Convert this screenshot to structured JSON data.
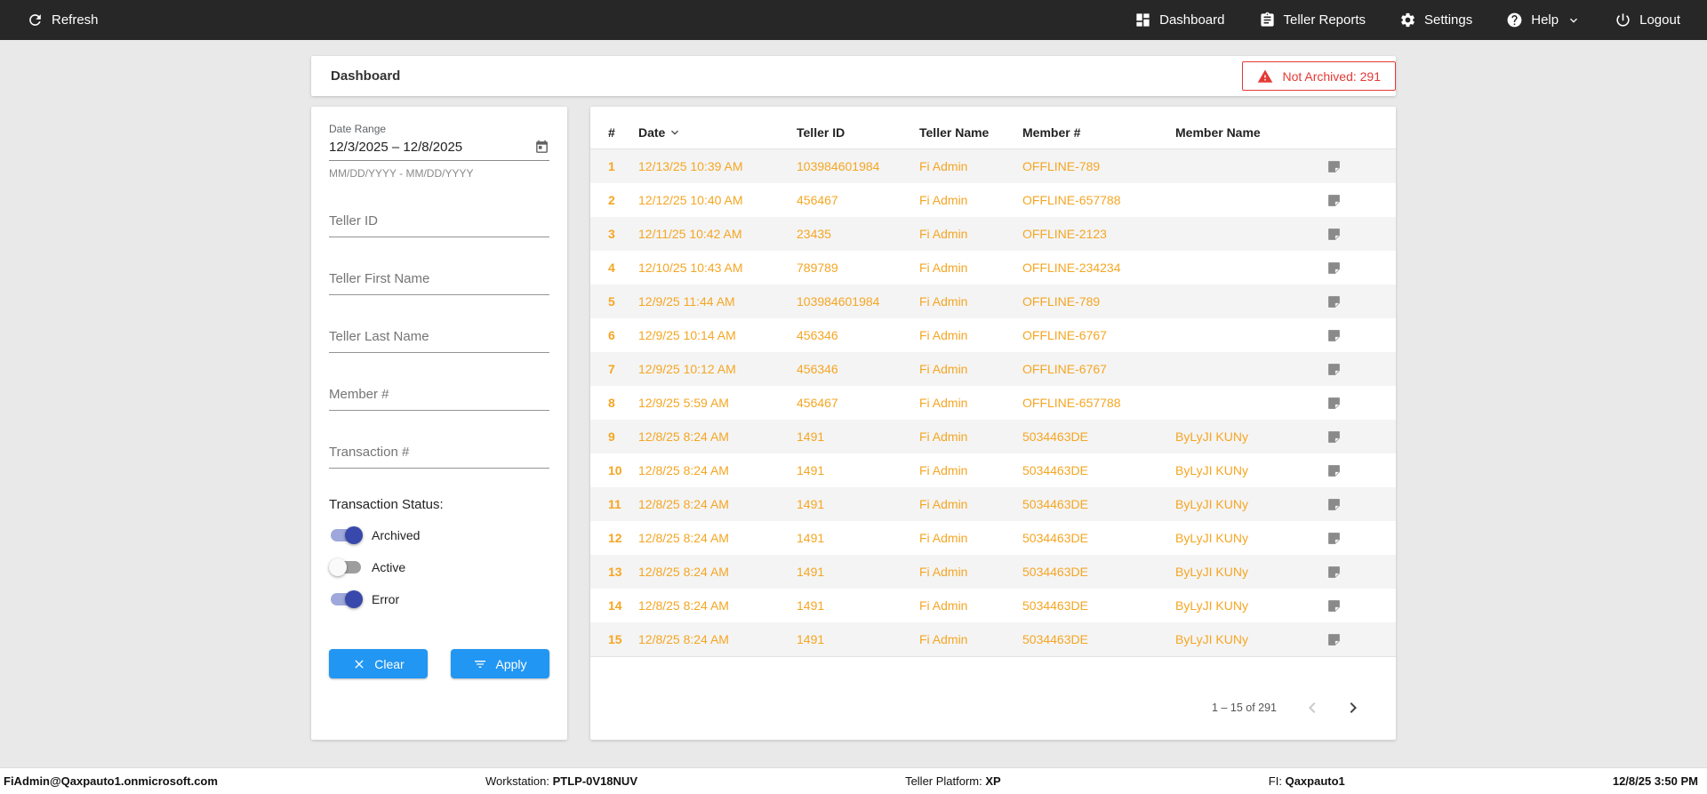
{
  "colors": {
    "topbar_bg": "#272727",
    "accent_orange": "#F5A623",
    "button_blue": "#2196F3",
    "alert_red": "#E53935",
    "toggle_on": "#3949AB"
  },
  "topbar": {
    "refresh_label": "Refresh",
    "nav": [
      {
        "label": "Dashboard",
        "icon": "dashboard-icon"
      },
      {
        "label": "Teller Reports",
        "icon": "reports-icon"
      },
      {
        "label": "Settings",
        "icon": "settings-icon"
      },
      {
        "label": "Help",
        "icon": "help-icon"
      },
      {
        "label": "Logout",
        "icon": "logout-icon"
      }
    ]
  },
  "page": {
    "title": "Dashboard",
    "alert_label": "Not Archived: 291"
  },
  "filters": {
    "date_range": {
      "label": "Date Range",
      "value": "12/3/2025 – 12/8/2025",
      "helper": "MM/DD/YYYY - MM/DD/YYYY"
    },
    "fields": [
      {
        "placeholder": "Teller ID"
      },
      {
        "placeholder": "Teller First Name"
      },
      {
        "placeholder": "Teller Last Name"
      },
      {
        "placeholder": "Member #"
      },
      {
        "placeholder": "Transaction #"
      }
    ],
    "status": {
      "label": "Transaction Status:",
      "toggles": [
        {
          "label": "Archived",
          "on": true
        },
        {
          "label": "Active",
          "on": false
        },
        {
          "label": "Error",
          "on": true
        }
      ]
    },
    "clear_label": "Clear",
    "apply_label": "Apply"
  },
  "table": {
    "columns": {
      "num": "#",
      "date": "Date",
      "teller_id": "Teller ID",
      "teller_name": "Teller Name",
      "member": "Member #",
      "member_name": "Member Name"
    },
    "rows": [
      {
        "num": "1",
        "date": "12/13/25 10:39 AM",
        "teller_id": "103984601984",
        "teller_name": "Fi Admin",
        "member": "OFFLINE-789",
        "member_name": ""
      },
      {
        "num": "2",
        "date": "12/12/25 10:40 AM",
        "teller_id": "456467",
        "teller_name": "Fi Admin",
        "member": "OFFLINE-657788",
        "member_name": ""
      },
      {
        "num": "3",
        "date": "12/11/25 10:42 AM",
        "teller_id": "23435",
        "teller_name": "Fi Admin",
        "member": "OFFLINE-2123",
        "member_name": ""
      },
      {
        "num": "4",
        "date": "12/10/25 10:43 AM",
        "teller_id": "789789",
        "teller_name": "Fi Admin",
        "member": "OFFLINE-234234",
        "member_name": ""
      },
      {
        "num": "5",
        "date": "12/9/25 11:44 AM",
        "teller_id": "103984601984",
        "teller_name": "Fi Admin",
        "member": "OFFLINE-789",
        "member_name": ""
      },
      {
        "num": "6",
        "date": "12/9/25 10:14 AM",
        "teller_id": "456346",
        "teller_name": "Fi Admin",
        "member": "OFFLINE-6767",
        "member_name": ""
      },
      {
        "num": "7",
        "date": "12/9/25 10:12 AM",
        "teller_id": "456346",
        "teller_name": "Fi Admin",
        "member": "OFFLINE-6767",
        "member_name": ""
      },
      {
        "num": "8",
        "date": "12/9/25 5:59 AM",
        "teller_id": "456467",
        "teller_name": "Fi Admin",
        "member": "OFFLINE-657788",
        "member_name": ""
      },
      {
        "num": "9",
        "date": "12/8/25 8:24 AM",
        "teller_id": "1491",
        "teller_name": "Fi Admin",
        "member": "5034463DE",
        "member_name": "ByLyJI KUNy"
      },
      {
        "num": "10",
        "date": "12/8/25 8:24 AM",
        "teller_id": "1491",
        "teller_name": "Fi Admin",
        "member": "5034463DE",
        "member_name": "ByLyJI KUNy"
      },
      {
        "num": "11",
        "date": "12/8/25 8:24 AM",
        "teller_id": "1491",
        "teller_name": "Fi Admin",
        "member": "5034463DE",
        "member_name": "ByLyJI KUNy"
      },
      {
        "num": "12",
        "date": "12/8/25 8:24 AM",
        "teller_id": "1491",
        "teller_name": "Fi Admin",
        "member": "5034463DE",
        "member_name": "ByLyJI KUNy"
      },
      {
        "num": "13",
        "date": "12/8/25 8:24 AM",
        "teller_id": "1491",
        "teller_name": "Fi Admin",
        "member": "5034463DE",
        "member_name": "ByLyJI KUNy"
      },
      {
        "num": "14",
        "date": "12/8/25 8:24 AM",
        "teller_id": "1491",
        "teller_name": "Fi Admin",
        "member": "5034463DE",
        "member_name": "ByLyJI KUNy"
      },
      {
        "num": "15",
        "date": "12/8/25 8:24 AM",
        "teller_id": "1491",
        "teller_name": "Fi Admin",
        "member": "5034463DE",
        "member_name": "ByLyJI KUNy"
      }
    ],
    "pagination": {
      "label": "1 – 15 of 291"
    }
  },
  "statusbar": {
    "user": "FiAdmin@Qaxpauto1.onmicrosoft.com",
    "workstation_label": "Workstation:",
    "workstation_value": "PTLP-0V18NUV",
    "platform_label": "Teller Platform:",
    "platform_value": "XP",
    "fi_label": "FI:",
    "fi_value": "Qaxpauto1",
    "datetime": "12/8/25 3:50 PM"
  }
}
